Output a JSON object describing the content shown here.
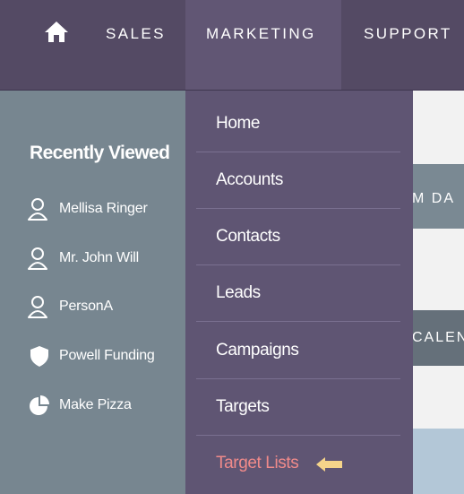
{
  "nav": {
    "home_icon": "home-icon",
    "items": [
      {
        "label": "SALES"
      },
      {
        "label": "MARKETING"
      },
      {
        "label": "SUPPORT"
      }
    ],
    "bar_color": "#544a64",
    "active_tab_color": "#615674"
  },
  "background": {
    "strip_a_text": "M DA",
    "strip_b_text": "CALEN"
  },
  "recently_viewed": {
    "title": "Recently Viewed",
    "items": [
      {
        "label": "Mellisa Ringer",
        "icon": "person-icon"
      },
      {
        "label": "Mr. John Will",
        "icon": "person-icon"
      },
      {
        "label": "PersonA",
        "icon": "person-icon"
      },
      {
        "label": "Powell Funding",
        "icon": "shield-icon"
      },
      {
        "label": "Make Pizza",
        "icon": "pie-chart-icon"
      }
    ]
  },
  "marketing_menu": {
    "items": [
      {
        "label": "Home"
      },
      {
        "label": "Accounts"
      },
      {
        "label": "Contacts"
      },
      {
        "label": "Leads"
      },
      {
        "label": "Campaigns"
      },
      {
        "label": "Targets"
      },
      {
        "label": "Target Lists",
        "highlighted": true
      }
    ],
    "highlight_color": "#f08a8a",
    "pointer_icon": "arrow-left-icon",
    "pointer_color": "#f5d48a"
  }
}
